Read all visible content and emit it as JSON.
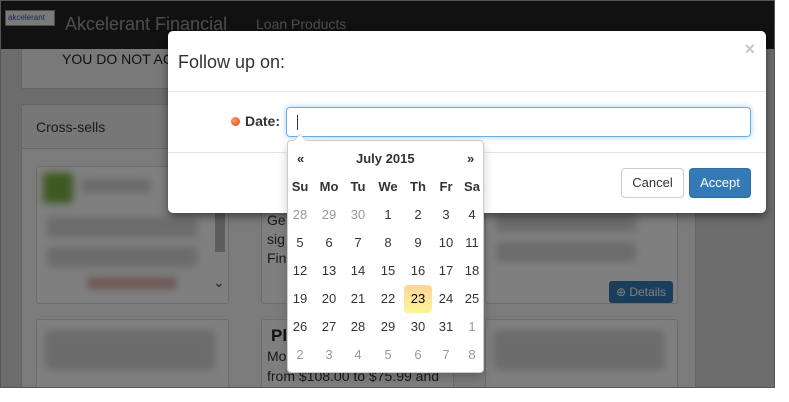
{
  "app": {
    "brand": "Akcelerant Financial",
    "logo_text": "akcelerant",
    "nav_link": "Loan Products"
  },
  "background": {
    "warning_text": "YOU DO NOT AC",
    "cross_sells_title": "Cross-sells",
    "card2_lines": [
      "Ge",
      "sig",
      "Fin"
    ],
    "card3_heading": "Pl",
    "card3_lines": [
      "Mo",
      "from $108.00 to $75.99 and"
    ],
    "details_label": "Details"
  },
  "modal": {
    "title": "Follow up on:",
    "close_glyph": "×",
    "date_label": "Date:",
    "date_value": "",
    "cancel_label": "Cancel",
    "accept_label": "Accept"
  },
  "datepicker": {
    "prev": "«",
    "next": "»",
    "month_label": "July 2015",
    "dow": [
      "Su",
      "Mo",
      "Tu",
      "We",
      "Th",
      "Fr",
      "Sa"
    ],
    "today": 23,
    "weeks": [
      [
        {
          "d": "28",
          "m": true
        },
        {
          "d": "29",
          "m": true
        },
        {
          "d": "30",
          "m": true
        },
        {
          "d": "1"
        },
        {
          "d": "2"
        },
        {
          "d": "3"
        },
        {
          "d": "4"
        }
      ],
      [
        {
          "d": "5"
        },
        {
          "d": "6"
        },
        {
          "d": "7"
        },
        {
          "d": "8"
        },
        {
          "d": "9"
        },
        {
          "d": "10"
        },
        {
          "d": "11"
        }
      ],
      [
        {
          "d": "12"
        },
        {
          "d": "13"
        },
        {
          "d": "14"
        },
        {
          "d": "15"
        },
        {
          "d": "16"
        },
        {
          "d": "17"
        },
        {
          "d": "18"
        }
      ],
      [
        {
          "d": "19"
        },
        {
          "d": "20"
        },
        {
          "d": "21"
        },
        {
          "d": "22"
        },
        {
          "d": "23",
          "t": true
        },
        {
          "d": "24"
        },
        {
          "d": "25"
        }
      ],
      [
        {
          "d": "26"
        },
        {
          "d": "27"
        },
        {
          "d": "28"
        },
        {
          "d": "29"
        },
        {
          "d": "30"
        },
        {
          "d": "31"
        },
        {
          "d": "1",
          "m": true
        }
      ],
      [
        {
          "d": "2",
          "m": true
        },
        {
          "d": "3",
          "m": true
        },
        {
          "d": "4",
          "m": true
        },
        {
          "d": "5",
          "m": true
        },
        {
          "d": "6",
          "m": true
        },
        {
          "d": "7",
          "m": true
        },
        {
          "d": "8",
          "m": true
        }
      ]
    ]
  },
  "colors": {
    "primary": "#337ab7",
    "today_highlight": "#fdd49a",
    "required_dot": "#d9441c"
  }
}
